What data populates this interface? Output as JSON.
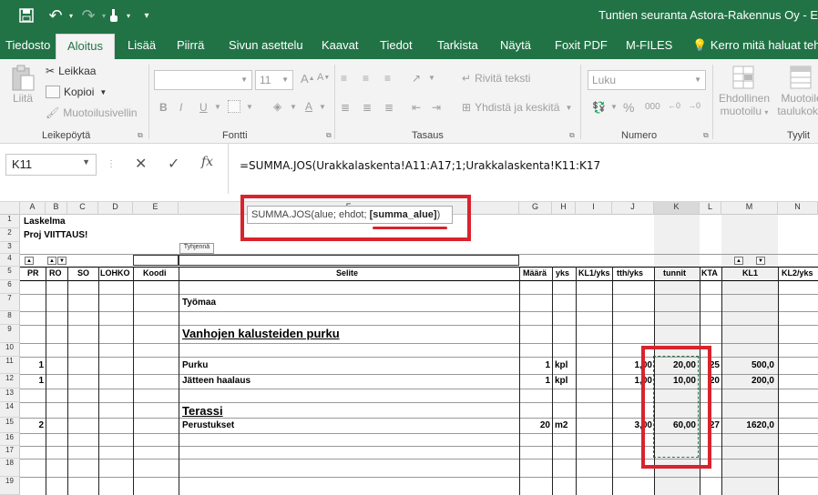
{
  "title": "Tuntien seuranta Astora-Rakennus Oy  -  E",
  "qat": {
    "save": "save-icon",
    "undo": "↶",
    "redo": "↷",
    "touch": "touch-icon",
    "more": "▾"
  },
  "tabs": [
    "Tiedosto",
    "Aloitus",
    "Lisää",
    "Piirrä",
    "Sivun asettelu",
    "Kaavat",
    "Tiedot",
    "Tarkista",
    "Näytä",
    "Foxit PDF",
    "M-FILES"
  ],
  "tell_me": "Kerro mitä haluat tehdä",
  "ribbon": {
    "paste": "Liitä",
    "cut": "Leikkaa",
    "copy": "Kopioi",
    "format_painter": "Muotoilusivellin",
    "clipboard_group": "Leikepöytä",
    "font_size": "11",
    "bold": "B",
    "italic": "I",
    "underline": "U",
    "font_group": "Fontti",
    "wrap_text": "Rivitä teksti",
    "merge_center": "Yhdistä ja keskitä",
    "alignment_group": "Tasaus",
    "number_format": "Luku",
    "percent": "%",
    "thousands": "000",
    "number_group": "Numero",
    "conditional_1": "Ehdollinen",
    "conditional_2": "muotoilu",
    "table_1": "Muotoile",
    "table_2": "taulukoksi",
    "styles_group": "Tyylit"
  },
  "formula_bar": {
    "name_box": "K11",
    "cancel": "✕",
    "enter": "✓",
    "fx": "fx",
    "formula": "=SUMMA.JOS(Urakkalaskenta!A11:A17;1;Urakkalaskenta!K11:K17"
  },
  "tooltip": {
    "prefix": "SUMMA.JOS(alue; ehdot; ",
    "bold": "[summa_alue]",
    "suffix": ")"
  },
  "columns": [
    "A",
    "B",
    "C",
    "D",
    "E",
    "F",
    "G",
    "H",
    "I",
    "J",
    "K",
    "L",
    "M",
    "N"
  ],
  "rows": [
    "1",
    "2",
    "3",
    "4",
    "5",
    "6",
    "7",
    "8",
    "9",
    "10",
    "11",
    "12",
    "13",
    "14",
    "15",
    "16",
    "17",
    "18",
    "19"
  ],
  "sheet": {
    "r1": "Laskelma",
    "r2": "Proj VIITTAUS!",
    "r3_note": "Tyhjennä",
    "headers": [
      "PR",
      "RO",
      "SO",
      "LOHKO",
      "Koodi",
      "Selite",
      "Määrä",
      "yks",
      "KL1/yks",
      "tth/yks",
      "tunnit",
      "KTA",
      "KL1",
      "KL2/yks"
    ],
    "tyomaa": "Työmaa",
    "section1": "Vanhojen kalusteiden purku",
    "section2": "Terassi",
    "rows": [
      {
        "pr": "1",
        "selite": "Purku",
        "maara": "1",
        "yks": "kpl",
        "tth": "1,00",
        "tunnit": "20,00",
        "kta": "25",
        "kl1": "500,0"
      },
      {
        "pr": "1",
        "selite": "Jätteen haalaus",
        "maara": "1",
        "yks": "kpl",
        "tth": "1,00",
        "tunnit": "10,00",
        "kta": "20",
        "kl1": "200,0"
      },
      {
        "pr": "2",
        "selite": "Perustukset",
        "maara": "20",
        "yks": "m2",
        "tth": "3,00",
        "tunnit": "60,00",
        "kta": "27",
        "kl1": "1620,0"
      }
    ]
  },
  "colors": {
    "accent": "#217346",
    "highlight": "#d9232d"
  }
}
